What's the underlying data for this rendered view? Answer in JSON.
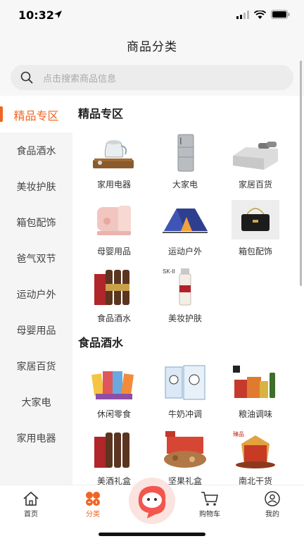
{
  "status_bar": {
    "time": "10:32"
  },
  "header": {
    "title": "商品分类"
  },
  "search": {
    "placeholder": "点击搜索商品信息"
  },
  "sidebar": {
    "items": [
      {
        "label": "精品专区",
        "active": true
      },
      {
        "label": "食品酒水"
      },
      {
        "label": "美妆护肤"
      },
      {
        "label": "箱包配饰"
      },
      {
        "label": "爸气双节"
      },
      {
        "label": "运动户外"
      },
      {
        "label": "母婴用品"
      },
      {
        "label": "家居百货"
      },
      {
        "label": "大家电"
      },
      {
        "label": "家用电器"
      }
    ]
  },
  "sections": [
    {
      "title": "精品专区",
      "items": [
        {
          "label": "家用电器",
          "icon": "kettle-image"
        },
        {
          "label": "大家电",
          "icon": "fridge-image"
        },
        {
          "label": "家居百货",
          "icon": "bed-image"
        },
        {
          "label": "母婴用品",
          "icon": "baby-food-maker-image"
        },
        {
          "label": "运动户外",
          "icon": "tent-image"
        },
        {
          "label": "箱包配饰",
          "icon": "handbag-image"
        },
        {
          "label": "食品酒水",
          "icon": "wine-bottles-image"
        },
        {
          "label": "美妆护肤",
          "icon": "skincare-bottle-image"
        }
      ]
    },
    {
      "title": "食品酒水",
      "items": [
        {
          "label": "休闲零食",
          "icon": "snacks-image"
        },
        {
          "label": "牛奶冲调",
          "icon": "milk-boxes-image"
        },
        {
          "label": "粮油调味",
          "icon": "grain-oil-image"
        },
        {
          "label": "美酒礼盒",
          "icon": "liquor-gift-box-image"
        },
        {
          "label": "坚果礼盒",
          "icon": "nut-gift-box-image"
        },
        {
          "label": "南北干货",
          "icon": "dried-goods-image"
        }
      ]
    }
  ],
  "image_text": {
    "skii": "SK-II",
    "logo_mini": "臻品"
  },
  "tab_bar": {
    "tabs": [
      {
        "label": "首页",
        "icon": "home-icon"
      },
      {
        "label": "分类",
        "icon": "category-icon",
        "active": true
      },
      {
        "label": "购物车",
        "icon": "cart-icon"
      },
      {
        "label": "我的",
        "icon": "profile-icon"
      }
    ]
  },
  "colors": {
    "accent": "#f06524",
    "sidebar_bg": "#f5f5f5",
    "header_bg": "#f7f7f7"
  }
}
